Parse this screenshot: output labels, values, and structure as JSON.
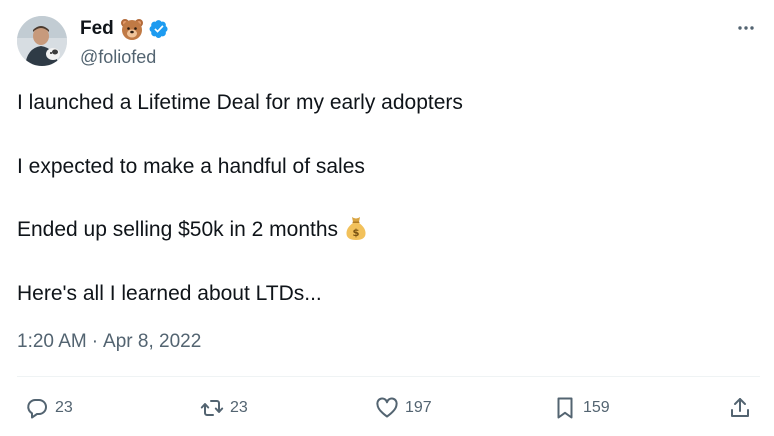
{
  "author": {
    "display_name": "Fed",
    "handle": "@foliofed",
    "verified": true,
    "name_emoji": "bear-icon",
    "verified_color": "#1d9bf0"
  },
  "tweet": {
    "lines": [
      "I launched a Lifetime Deal for my early adopters",
      "I expected to make a handful of sales",
      "Ended up selling $50k in 2 months",
      "Here's all I learned about LTDs..."
    ],
    "inline_emoji": "moneybag-icon",
    "time": "1:20 AM",
    "separator": "·",
    "date": "Apr 8, 2022"
  },
  "actions": {
    "replies": "23",
    "retweets": "23",
    "likes": "197",
    "bookmarks": "159"
  },
  "colors": {
    "text": "#0f1419",
    "secondary": "#536471",
    "divider": "#eff3f4"
  }
}
